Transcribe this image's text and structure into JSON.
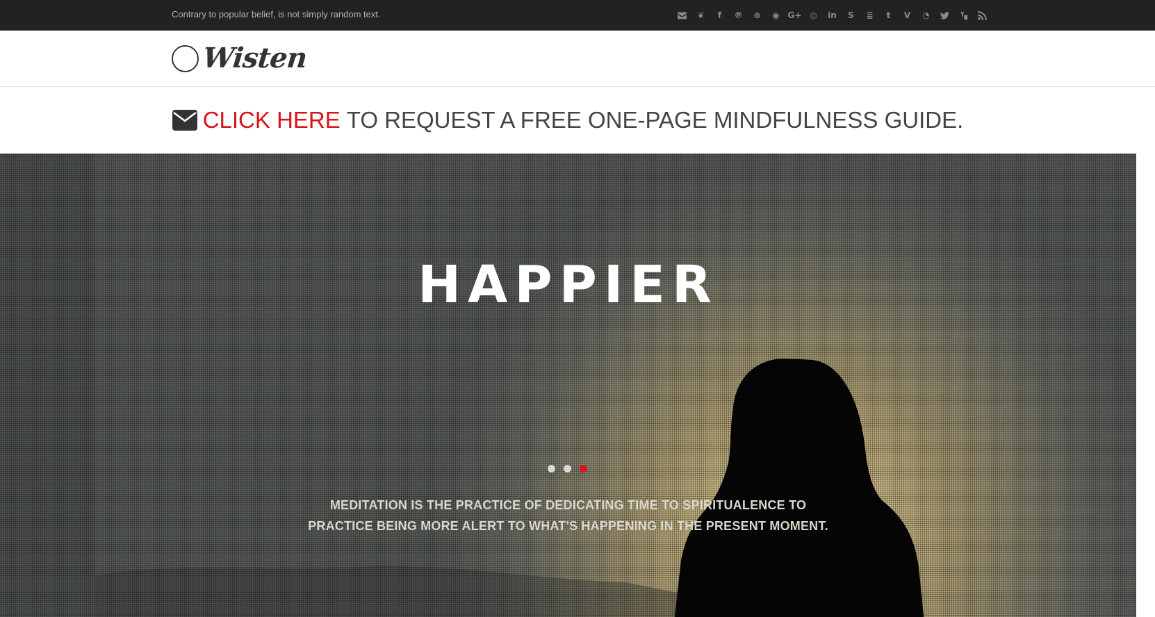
{
  "topbar": {
    "tagline": "Contrary to popular belief, is not simply random text.",
    "social_icons": [
      "envelope-icon",
      "drupal-icon",
      "facebook-icon",
      "pinterest-icon",
      "dribbble-icon",
      "github-icon",
      "google-plus-icon",
      "instagram-icon",
      "linkedin-icon",
      "skype-icon",
      "stack-icon",
      "tumblr-icon",
      "vimeo-icon",
      "weibo-icon",
      "twitter-icon",
      "youtube-icon",
      "rss-icon"
    ],
    "social_glyphs": [
      "✉",
      "❦",
      "f",
      "℗",
      "⊛",
      "◉",
      "G+",
      "◎",
      "in",
      "S",
      "≣",
      "t",
      "V",
      "◔",
      "🐦",
      "▶",
      "◠"
    ]
  },
  "header": {
    "logo_text": "Wisten"
  },
  "promo": {
    "link_text": "CLICK HERE",
    "rest_text": "TO REQUEST A FREE ONE-PAGE MINDFULNESS GUIDE."
  },
  "hero": {
    "title": "HAPPIER",
    "caption_line1": "MEDITATION IS THE PRACTICE OF DEDICATING TIME TO SPIRITUALENCE TO",
    "caption_line2": "PRACTICE BEING MORE ALERT TO WHAT'S HAPPENING IN THE PRESENT MOMENT.",
    "slides": 3,
    "active_slide": 3
  },
  "colors": {
    "accent": "#d6141b",
    "topbar_bg": "#222222",
    "text_dark": "#444444"
  }
}
